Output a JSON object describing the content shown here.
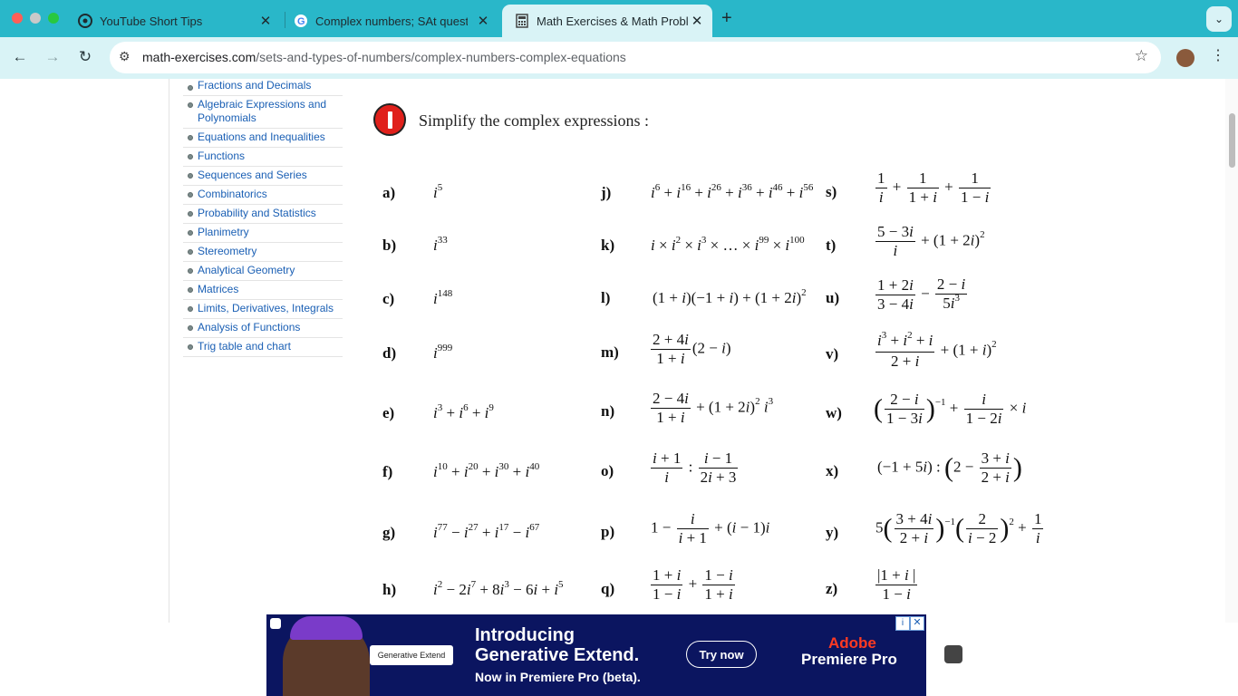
{
  "browser": {
    "tabs": [
      {
        "title": "YouTube Short Tips",
        "icon": "chatgpt-icon"
      },
      {
        "title": "Complex numbers; SAt quest",
        "icon": "google-icon"
      },
      {
        "title": "Math Exercises & Math Proble",
        "icon": "calculator-icon"
      }
    ],
    "url_domain": "math-exercises.com",
    "url_path": "/sets-and-types-of-numbers/complex-numbers-complex-equations"
  },
  "sidebar": {
    "items": [
      "Fractions and Decimals",
      "Algebraic Expressions and Polynomials",
      "Equations and Inequalities",
      "Functions",
      "Sequences and Series",
      "Combinatorics",
      "Probability and Statistics",
      "Planimetry",
      "Stereometry",
      "Analytical Geometry",
      "Matrices",
      "Limits, Derivatives, Integrals",
      "Analysis of Functions",
      "Trig table and chart"
    ]
  },
  "main": {
    "heading": "Simplify the complex expressions :",
    "labels": [
      "a)",
      "b)",
      "c)",
      "d)",
      "e)",
      "f)",
      "g)",
      "h)",
      "j)",
      "k)",
      "l)",
      "m)",
      "n)",
      "o)",
      "p)",
      "q)",
      "s)",
      "t)",
      "u)",
      "v)",
      "w)",
      "x)",
      "y)",
      "z)"
    ]
  },
  "ad": {
    "headline1": "Introducing",
    "headline2": "Generative Extend.",
    "subline": "Now in Premiere Pro (beta).",
    "pill": "Generative Extend",
    "cta": "Try now",
    "brand_top": "Adobe",
    "brand_bottom": "Premiere Pro"
  },
  "colors": {
    "tabstrip": "#29b7c9",
    "toolbar": "#d9f3f6",
    "link": "#1a5fb4",
    "ad_bg": "#0b1560"
  }
}
